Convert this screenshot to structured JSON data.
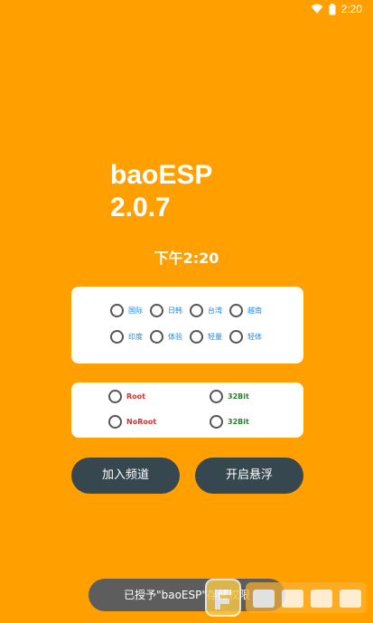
{
  "status_bar": {
    "time": "2:20",
    "icons": [
      "wifi-icon",
      "battery-icon"
    ]
  },
  "app": {
    "title_line1": "baoESP",
    "title_line2": "2.0.7",
    "clock": "下午2:20"
  },
  "regions": [
    [
      "国际",
      "日韩",
      "台湾",
      "越南"
    ],
    [
      "印度",
      "体验",
      "轻量",
      "轻体"
    ]
  ],
  "modes": {
    "root": "Root",
    "noroot": "NoRoot",
    "bit32_a": "32Bit",
    "bit32_b": "32Bit"
  },
  "buttons": {
    "join": "加入频道",
    "float": "开启悬浮"
  },
  "toast": "已授予\"baoESP\"存储权限",
  "colors": {
    "background": "#ffa000",
    "button": "#37474f",
    "region_label": "#1e88e5",
    "root_label": "#d32f2f",
    "bit_label": "#2e7d32"
  }
}
